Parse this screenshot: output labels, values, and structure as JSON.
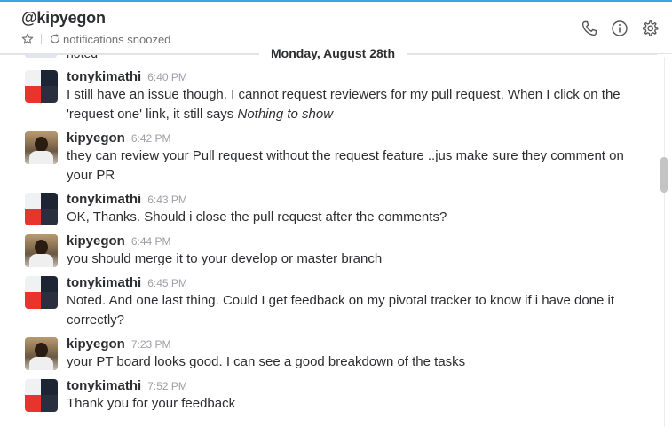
{
  "header": {
    "channel_title": "@kipyegon",
    "status_text": "notifications snoozed",
    "actions": [
      "phone-icon",
      "info-icon",
      "gear-icon"
    ]
  },
  "day_divider": "Monday, August 28th",
  "partial_previous": "noted",
  "messages": [
    {
      "author": "tonykimathi",
      "time": "6:40 PM",
      "avatar": "tony",
      "text_before": "I still have an issue though. I cannot request reviewers for my pull request. When I click on the 'request one' link, it still says ",
      "text_em": "Nothing to show"
    },
    {
      "author": "kipyegon",
      "time": "6:42 PM",
      "avatar": "kip",
      "text": "they can review your Pull request without the request feature ..jus make sure they comment on your PR"
    },
    {
      "author": "tonykimathi",
      "time": "6:43 PM",
      "avatar": "tony",
      "text": "OK, Thanks. Should i close the pull request after the comments?"
    },
    {
      "author": "kipyegon",
      "time": "6:44 PM",
      "avatar": "kip",
      "text": "you should merge it to your develop or master branch"
    },
    {
      "author": "tonykimathi",
      "time": "6:45 PM",
      "avatar": "tony",
      "text": "Noted. And one last thing. Could I get feedback on my pivotal tracker to know if i have done it correctly?"
    },
    {
      "author": "kipyegon",
      "time": "7:23 PM",
      "avatar": "kip",
      "text": "your PT board looks good. I can see a good breakdown of the tasks"
    },
    {
      "author": "tonykimathi",
      "time": "7:52 PM",
      "avatar": "tony",
      "text": "Thank you for your feedback"
    }
  ],
  "colors": {
    "accent": "#3aa3e3",
    "text": "#2c2d30",
    "muted": "#9e9ea6",
    "avatar_red": "#e8342c"
  }
}
